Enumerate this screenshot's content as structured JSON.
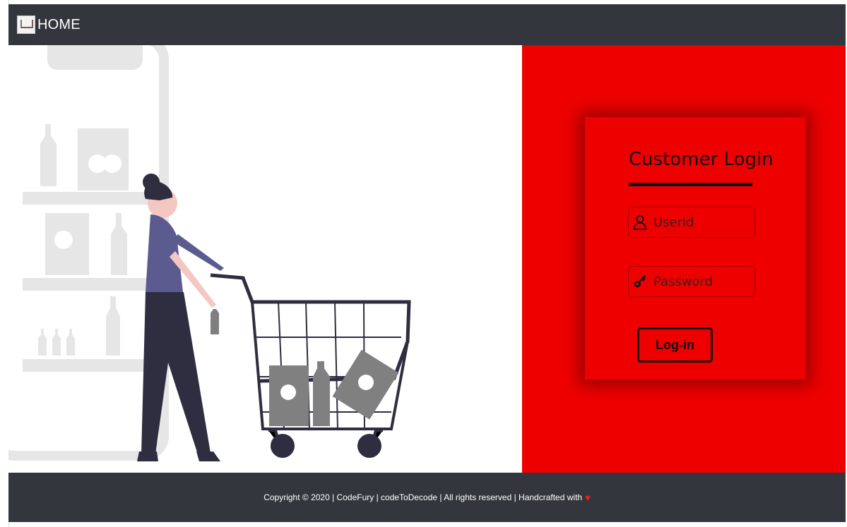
{
  "navbar": {
    "brand_text": "HOME",
    "brand_icon": "cart-logo-icon"
  },
  "login": {
    "title": "Customer Login",
    "userid_placeholder": "Userid",
    "password_placeholder": "Password",
    "button_label": "Log-in"
  },
  "footer": {
    "text": "Copyright © 2020 | CodeFury | codeToDecode | All rights reserved | Handcrafted with",
    "heart_icon": "heart-icon"
  },
  "colors": {
    "accent": "#ee0000",
    "dark": "#33373d",
    "text": "#111111"
  }
}
